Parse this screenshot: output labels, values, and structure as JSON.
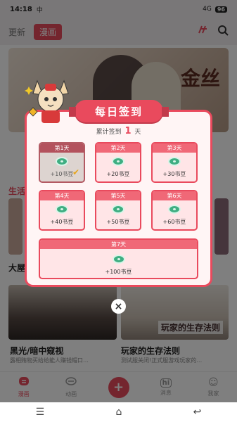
{
  "status_bar": {
    "time": "14:18",
    "left_icon": "中",
    "signal": "4G",
    "battery": "96"
  },
  "top_nav": {
    "tabs": [
      {
        "label": "更新"
      },
      {
        "label": "漫画"
      }
    ],
    "icons": [
      "filter-icon",
      "search-icon"
    ]
  },
  "background": {
    "banner_title": "金丝",
    "section_label": "生活",
    "section2_label": "大屋",
    "cards": [
      {
        "title": "黑光/暗中窥视",
        "desc": "露相贿物买给给能人赚钱帽口…"
      },
      {
        "title": "玩家的生存法则",
        "desc": "测试服关闭!正式服游戏玩家的…",
        "overlay": "玩家的生存法则"
      }
    ]
  },
  "popup": {
    "title": "每日签到",
    "accum_prefix": "累计签到",
    "accum_days": "1",
    "accum_suffix": "天",
    "days": [
      {
        "label": "第1天",
        "reward": "+10书豆",
        "done": true
      },
      {
        "label": "第2天",
        "reward": "+20书豆",
        "done": false
      },
      {
        "label": "第3天",
        "reward": "+30书豆",
        "done": false
      },
      {
        "label": "第4天",
        "reward": "+40书豆",
        "done": false
      },
      {
        "label": "第5天",
        "reward": "+50书豆",
        "done": false
      },
      {
        "label": "第6天",
        "reward": "+60书豆",
        "done": false
      },
      {
        "label": "第7天",
        "reward": "+100书豆",
        "done": false
      }
    ],
    "close_icon": "×"
  },
  "tab_bar": [
    {
      "label": "漫画",
      "icon": "▭",
      "active": true
    },
    {
      "label": "动画",
      "icon": "◇"
    },
    {
      "label": "",
      "icon": "+"
    },
    {
      "label": "消息",
      "icon": "hi"
    },
    {
      "label": "我家",
      "icon": "☺"
    }
  ],
  "sys_nav": {
    "menu": "☰",
    "home": "⌂",
    "back": "↩"
  },
  "colors": {
    "accent": "#e94a5d",
    "coin": "#3fae82",
    "check": "#e6a61e"
  }
}
